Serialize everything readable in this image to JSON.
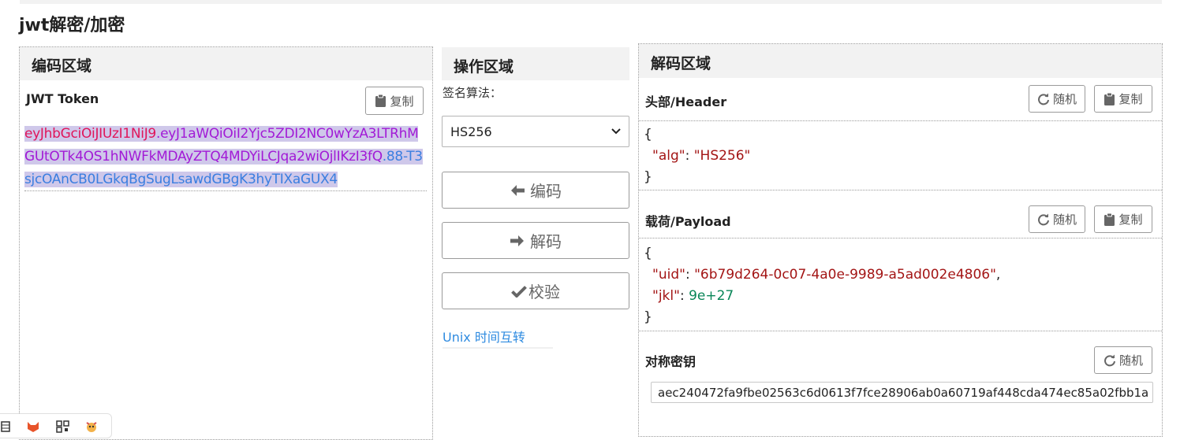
{
  "page": {
    "title": "jwt解密/加密"
  },
  "encode_panel": {
    "header": "编码区域",
    "token_label": "JWT Token",
    "copy_label": "复制",
    "token_header_part": "eyJhbGciOiJIUzI1NiJ9",
    "token_dot1": ".",
    "token_payload_part": "eyJ1aWQiOiI2Yjc5ZDI2NC0wYzA3LTRhMGUtOTk4OS1hNWFkMDAyZTQ4MDYiLCJqa2wiOjlIKzI3fQ",
    "token_dot2": ".",
    "token_signature_part": "88-T3sjcOAnCB0LGkqBgSugLsawdGBgK3hyTIXaGUX4"
  },
  "ops_panel": {
    "header": "操作区域",
    "algo_label": "签名算法：",
    "algo_selected": "HS256",
    "encode_label": "编码",
    "decode_label": "解码",
    "verify_label": "校验",
    "unix_link": "Unix 时间互转"
  },
  "decode_panel": {
    "header": "解码区域",
    "header_label": "头部/Header",
    "payload_label": "载荷/Payload",
    "random_label": "随机",
    "copy_label": "复制",
    "header_json": {
      "open": "{",
      "close": "}",
      "alg_key": "\"alg\"",
      "alg_value": "\"HS256\""
    },
    "payload_json": {
      "open": "{",
      "close": "}",
      "uid_key": "\"uid\"",
      "uid_value": "\"6b79d264-0c07-4a0e-9989-a5ad002e4806\"",
      "jkl_key": "\"jkl\"",
      "jkl_value": "9e+27"
    },
    "secret_label": "对称密钥",
    "secret_value": "aec240472fa9fbe02563c6d0613f7fce28906ab0a60719af448cda474ec85a02fbb1a"
  },
  "colors": {
    "token_header": "#e0155a",
    "token_payload": "#a21ad6",
    "token_signature": "#3a7ee0",
    "link": "#2f8be0"
  },
  "icons": [
    "clipboard-icon",
    "refresh-icon",
    "arrow-left-icon",
    "arrow-right-icon",
    "check-icon",
    "chevron-down-icon"
  ]
}
